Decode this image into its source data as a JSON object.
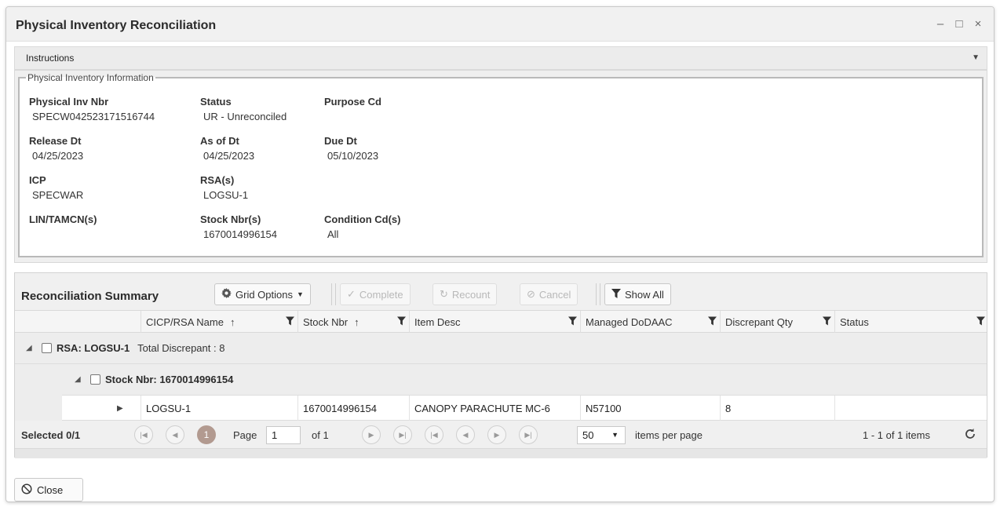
{
  "window": {
    "title": "Physical Inventory Reconciliation",
    "controls": {
      "minimize": "–",
      "maximize": "□",
      "close": "×"
    }
  },
  "instructions": {
    "label": "Instructions"
  },
  "info": {
    "legend": "Physical Inventory Information",
    "physical_inv_nbr": {
      "label": "Physical Inv Nbr",
      "value": "SPECW042523171516744"
    },
    "status": {
      "label": "Status",
      "value": "UR - Unreconciled"
    },
    "purpose_cd": {
      "label": "Purpose Cd",
      "value": ""
    },
    "release_dt": {
      "label": "Release Dt",
      "value": "04/25/2023"
    },
    "as_of_dt": {
      "label": "As of Dt",
      "value": "04/25/2023"
    },
    "due_dt": {
      "label": "Due Dt",
      "value": "05/10/2023"
    },
    "icp": {
      "label": "ICP",
      "value": "SPECWAR"
    },
    "rsas": {
      "label": "RSA(s)",
      "value": "LOGSU-1"
    },
    "lin_tamcn": {
      "label": "LIN/TAMCN(s)",
      "value": ""
    },
    "stock_nbrs": {
      "label": "Stock Nbr(s)",
      "value": "1670014996154"
    },
    "condition_cds": {
      "label": "Condition Cd(s)",
      "value": "All"
    }
  },
  "summary": {
    "title": "Reconciliation Summary",
    "toolbar": {
      "grid_options": "Grid Options",
      "complete": "Complete",
      "recount": "Recount",
      "cancel": "Cancel",
      "show_all": "Show All"
    },
    "columns": {
      "cicp_rsa_name": "CICP/RSA Name",
      "stock_nbr": "Stock Nbr",
      "item_desc": "Item Desc",
      "managed_dodaac": "Managed DoDAAC",
      "discrepant_qty": "Discrepant Qty",
      "status": "Status"
    },
    "group_rsa": {
      "label": "RSA: LOGSU-1",
      "extra": "Total Discrepant : 8"
    },
    "group_stock": {
      "label": "Stock Nbr: 1670014996154"
    },
    "row": {
      "cicp_rsa_name": "LOGSU-1",
      "stock_nbr": "1670014996154",
      "item_desc": "CANOPY PARACHUTE MC-6",
      "managed_dodaac": "N57100",
      "discrepant_qty": "8",
      "status": ""
    },
    "pager": {
      "selected": "Selected 0/1",
      "current_page_badge": "1",
      "page_label": "Page",
      "page_value": "1",
      "of_label": "of 1",
      "per_page_value": "50",
      "per_page_label": "items per page",
      "range": "1 - 1 of 1 items"
    }
  },
  "close_button": "Close"
}
